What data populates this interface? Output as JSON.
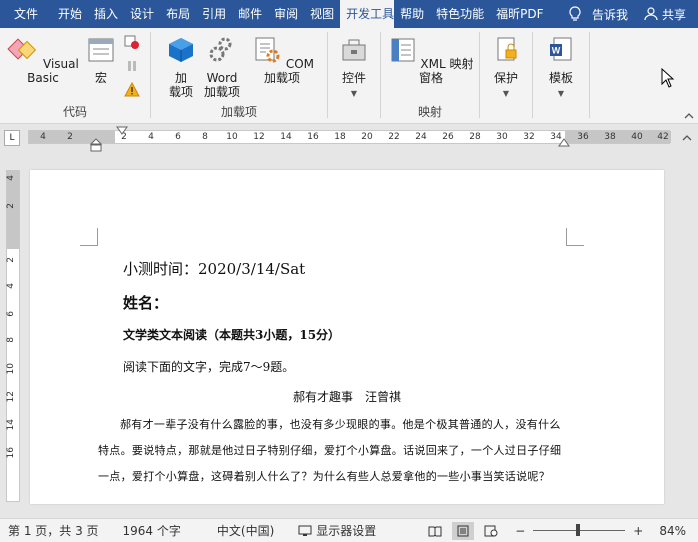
{
  "tabs": [
    {
      "label": "文件"
    },
    {
      "label": "开始"
    },
    {
      "label": "插入"
    },
    {
      "label": "设计"
    },
    {
      "label": "布局"
    },
    {
      "label": "引用"
    },
    {
      "label": "邮件"
    },
    {
      "label": "审阅"
    },
    {
      "label": "视图"
    },
    {
      "label": "开发工具",
      "active": true
    },
    {
      "label": "帮助"
    },
    {
      "label": "特色功能"
    },
    {
      "label": "福昕PDF"
    }
  ],
  "tell_me": "告诉我",
  "share": "共享",
  "ribbon": {
    "code_group": {
      "label": "代码",
      "visual_basic": "Visual Basic",
      "macro": "宏"
    },
    "addins_group": {
      "label": "加载项",
      "addins_line1": "加",
      "addins_line2": "载项",
      "word_addins_line1": "Word",
      "word_addins_line2": "加载项",
      "com_addins": "COM 加载项"
    },
    "controls_group": {
      "label": "",
      "controls": "控件"
    },
    "mapping_group": {
      "label": "映射",
      "xml_pane": "XML 映射窗格"
    },
    "protect_group": {
      "label": "",
      "protect": "保护"
    },
    "template_group": {
      "label": "",
      "template": "模板"
    }
  },
  "ruler_h": [
    "4",
    "2",
    "2",
    "4",
    "6",
    "8",
    "10",
    "12",
    "14",
    "16",
    "18",
    "20",
    "22",
    "24",
    "26",
    "28",
    "30",
    "32",
    "34",
    "36",
    "38",
    "40",
    "42"
  ],
  "ruler_v": [
    "4",
    "2",
    "2",
    "4",
    "6",
    "8",
    "10",
    "12",
    "14",
    "16"
  ],
  "document": {
    "line1": "小测时间：2020/3/14/Sat",
    "line2": "姓名：",
    "line3": "文学类文本阅读（本题共3小题，15分）",
    "line4": "阅读下面的文字，完成7～9题。",
    "line5": "郝有才趣事　汪曾祺",
    "paragraph": "郝有才一辈子没有什么露脸的事，也没有多少现眼的事。他是个极其普通的人，没有什么特点。要说特点，那就是他过日子特别仔细，爱打个小算盘。话说回来了，一个人过日子仔细一点，爱打个小算盘，这碍着别人什么了？为什么有些人总爱拿他的一些小事当笑话说呢？"
  },
  "status": {
    "page": "第 1 页，共 3 页",
    "words": "1964 个字",
    "language": "中文(中国)",
    "display": "显示器设置",
    "zoom": "84%",
    "zoom_minus": "−",
    "zoom_plus": "+",
    "zoom_level": 0.49
  },
  "colors": {
    "accent": "#2b579a"
  }
}
